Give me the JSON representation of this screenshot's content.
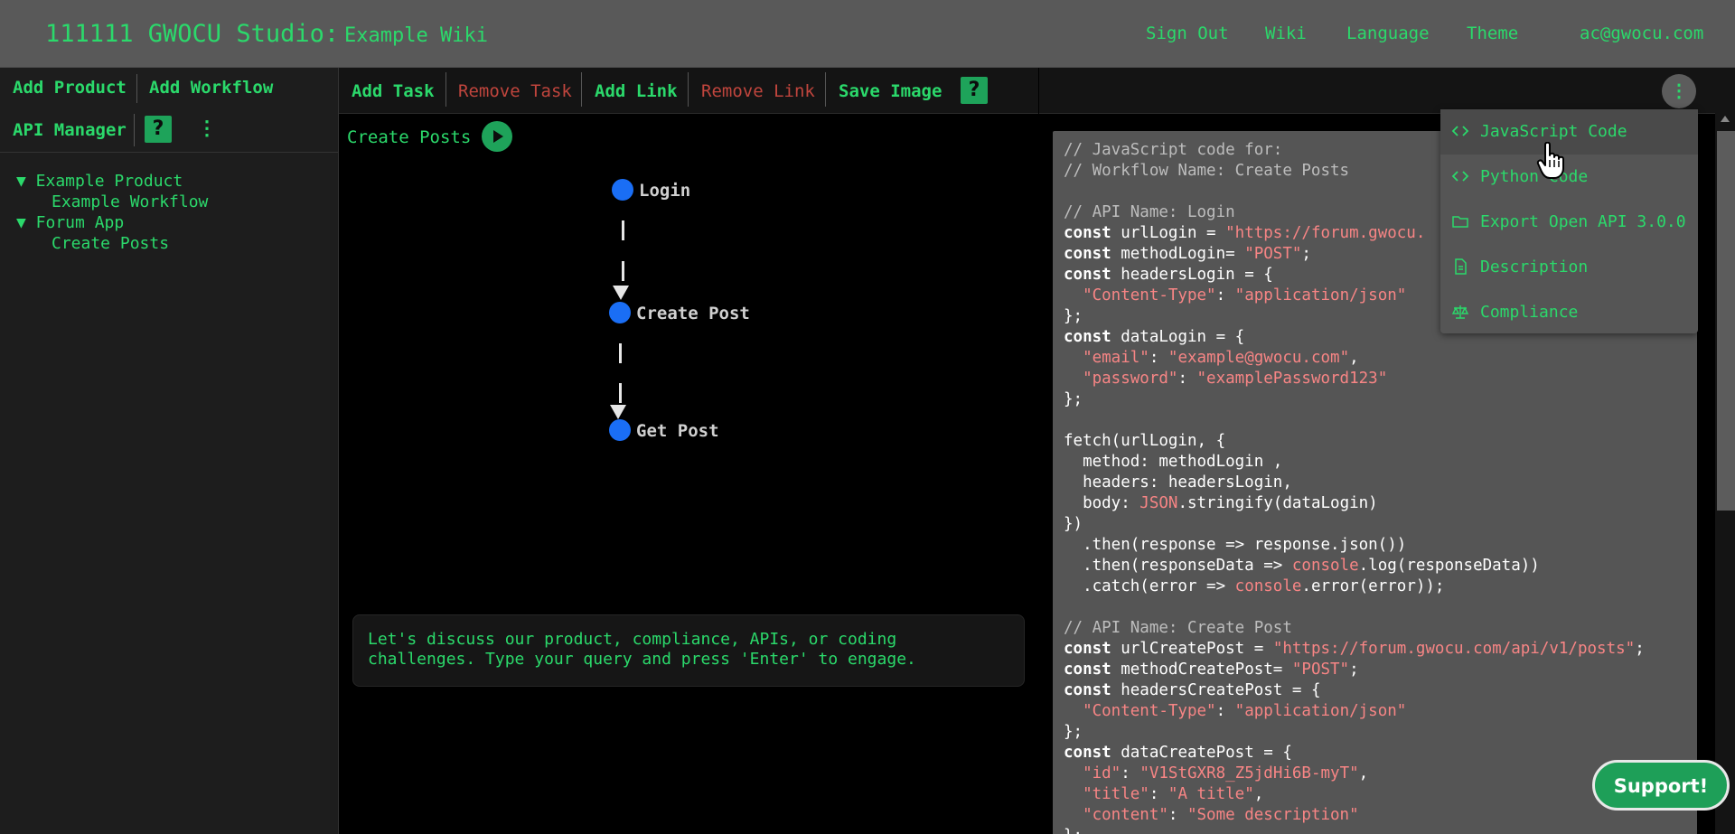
{
  "header": {
    "brand": "111111 GWOCU Studio:",
    "subtitle": "Example Wiki",
    "links": {
      "sign_out": "Sign Out",
      "wiki": "Wiki",
      "language": "Language",
      "theme": "Theme",
      "account": "ac@gwocu.com"
    }
  },
  "sidebar": {
    "add_product": "Add Product",
    "add_workflow": "Add Workflow",
    "api_manager": "API Manager",
    "help": "?",
    "more": "⋮",
    "tree": [
      {
        "label": "▼ Example Product",
        "children": [
          "Example Workflow"
        ]
      },
      {
        "label": "▼ Forum App",
        "children": [
          "Create Posts"
        ]
      }
    ]
  },
  "toolbar": {
    "add_task": "Add Task",
    "remove_task": "Remove Task",
    "add_link": "Add Link",
    "remove_link": "Remove Link",
    "save_image": "Save Image",
    "help": "?"
  },
  "workflow": {
    "name": "Create Posts",
    "nodes": [
      "Login",
      "Create Post",
      "Get Post"
    ]
  },
  "chat": {
    "prompt": "Let's discuss our product, compliance, APIs, or coding challenges. Type your query and press 'Enter' to engage."
  },
  "menu": {
    "kebab": "⋮",
    "items": [
      {
        "label": "JavaScript Code",
        "icon": "code-icon"
      },
      {
        "label": "Python Code",
        "icon": "code-icon"
      },
      {
        "label": "Export Open API 3.0.0",
        "icon": "folder-icon"
      },
      {
        "label": "Description",
        "icon": "document-icon"
      },
      {
        "label": "Compliance",
        "icon": "scale-icon"
      }
    ]
  },
  "code": {
    "lines": [
      [
        [
          "cm",
          "// JavaScript code for:"
        ]
      ],
      [
        [
          "cm",
          "// Workflow Name: Create Posts"
        ]
      ],
      [],
      [
        [
          "cm",
          "// API Name: Login"
        ]
      ],
      [
        [
          "kw",
          "const"
        ],
        [
          "pl",
          " urlLogin = "
        ],
        [
          "st",
          "\"https://forum.gwocu."
        ]
      ],
      [
        [
          "kw",
          "const"
        ],
        [
          "pl",
          " methodLogin= "
        ],
        [
          "st",
          "\"POST\""
        ],
        [
          "pl",
          ";"
        ]
      ],
      [
        [
          "kw",
          "const"
        ],
        [
          "pl",
          " headersLogin = {"
        ]
      ],
      [
        [
          "pl",
          "  "
        ],
        [
          "st",
          "\"Content-Type\""
        ],
        [
          "pl",
          ": "
        ],
        [
          "st",
          "\"application/json\""
        ]
      ],
      [
        [
          "pl",
          "};"
        ]
      ],
      [
        [
          "kw",
          "const"
        ],
        [
          "pl",
          " dataLogin = {"
        ]
      ],
      [
        [
          "pl",
          "  "
        ],
        [
          "st",
          "\"email\""
        ],
        [
          "pl",
          ": "
        ],
        [
          "st",
          "\"example@gwocu.com\""
        ],
        [
          "pl",
          ","
        ]
      ],
      [
        [
          "pl",
          "  "
        ],
        [
          "st",
          "\"password\""
        ],
        [
          "pl",
          ": "
        ],
        [
          "st",
          "\"examplePassword123\""
        ]
      ],
      [
        [
          "pl",
          "};"
        ]
      ],
      [],
      [
        [
          "pl",
          "fetch(urlLogin, {"
        ]
      ],
      [
        [
          "pl",
          "  method: methodLogin ,"
        ]
      ],
      [
        [
          "pl",
          "  headers: headersLogin,"
        ]
      ],
      [
        [
          "pl",
          "  body: "
        ],
        [
          "st",
          "JSON"
        ],
        [
          "pl",
          ".stringify(dataLogin)"
        ]
      ],
      [
        [
          "pl",
          "})"
        ]
      ],
      [
        [
          "pl",
          "  .then(response => response.json())"
        ]
      ],
      [
        [
          "pl",
          "  .then(responseData => "
        ],
        [
          "st",
          "console"
        ],
        [
          "pl",
          ".log(responseData))"
        ]
      ],
      [
        [
          "pl",
          "  .catch(error => "
        ],
        [
          "st",
          "console"
        ],
        [
          "pl",
          ".error(error));"
        ]
      ],
      [],
      [
        [
          "cm",
          "// API Name: Create Post"
        ]
      ],
      [
        [
          "kw",
          "const"
        ],
        [
          "pl",
          " urlCreatePost = "
        ],
        [
          "st",
          "\"https://forum.gwocu.com/api/v1/posts\""
        ],
        [
          "pl",
          ";"
        ]
      ],
      [
        [
          "kw",
          "const"
        ],
        [
          "pl",
          " methodCreatePost= "
        ],
        [
          "st",
          "\"POST\""
        ],
        [
          "pl",
          ";"
        ]
      ],
      [
        [
          "kw",
          "const"
        ],
        [
          "pl",
          " headersCreatePost = {"
        ]
      ],
      [
        [
          "pl",
          "  "
        ],
        [
          "st",
          "\"Content-Type\""
        ],
        [
          "pl",
          ": "
        ],
        [
          "st",
          "\"application/json\""
        ]
      ],
      [
        [
          "pl",
          "};"
        ]
      ],
      [
        [
          "kw",
          "const"
        ],
        [
          "pl",
          " dataCreatePost = {"
        ]
      ],
      [
        [
          "pl",
          "  "
        ],
        [
          "st",
          "\"id\""
        ],
        [
          "pl",
          ": "
        ],
        [
          "st",
          "\"V1StGXR8_Z5jdHi6B-myT\""
        ],
        [
          "pl",
          ","
        ]
      ],
      [
        [
          "pl",
          "  "
        ],
        [
          "st",
          "\"title\""
        ],
        [
          "pl",
          ": "
        ],
        [
          "st",
          "\"A title\""
        ],
        [
          "pl",
          ","
        ]
      ],
      [
        [
          "pl",
          "  "
        ],
        [
          "st",
          "\"content\""
        ],
        [
          "pl",
          ": "
        ],
        [
          "st",
          "\"Some description\""
        ]
      ],
      [
        [
          "pl",
          "};"
        ]
      ]
    ]
  },
  "support": "Support!",
  "colors": {
    "accent": "#2bd96b",
    "danger": "#c0453d",
    "node": "#1a6ef5",
    "header_bg": "#595959",
    "code_bg": "#555555"
  }
}
